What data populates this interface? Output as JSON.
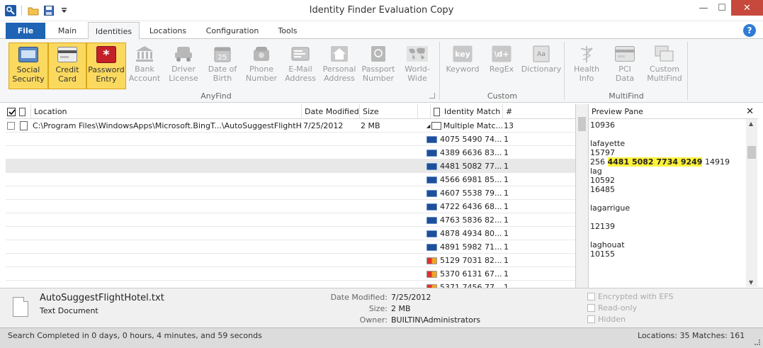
{
  "window": {
    "title": "Identity Finder Evaluation Copy",
    "controls": {
      "minimize": "—",
      "maximize": "☐",
      "close": "✕"
    }
  },
  "tabs": [
    {
      "label": "File"
    },
    {
      "label": "Main"
    },
    {
      "label": "Identities",
      "active": true
    },
    {
      "label": "Locations"
    },
    {
      "label": "Configuration"
    },
    {
      "label": "Tools"
    }
  ],
  "help_label": "?",
  "ribbon": {
    "anyfind": {
      "group_label": "AnyFind",
      "items": [
        {
          "label": "Social\nSecurity",
          "icon": "ssn-card-icon",
          "active": true
        },
        {
          "label": "Credit\nCard",
          "icon": "credit-card-icon",
          "active": true
        },
        {
          "label": "Password\nEntry",
          "icon": "password-icon",
          "active": true
        },
        {
          "label": "Bank\nAccount",
          "icon": "bank-icon"
        },
        {
          "label": "Driver\nLicense",
          "icon": "car-icon"
        },
        {
          "label": "Date of\nBirth",
          "icon": "calendar-icon",
          "icon_text": "25"
        },
        {
          "label": "Phone\nNumber",
          "icon": "phone-icon"
        },
        {
          "label": "E-Mail\nAddress",
          "icon": "email-icon"
        },
        {
          "label": "Personal\nAddress",
          "icon": "house-icon"
        },
        {
          "label": "Passport\nNumber",
          "icon": "passport-icon"
        },
        {
          "label": "World-\nWide",
          "icon": "world-map-icon"
        }
      ]
    },
    "custom": {
      "group_label": "Custom",
      "items": [
        {
          "label": "Keyword",
          "icon": "keyword-icon",
          "icon_text": "key"
        },
        {
          "label": "RegEx",
          "icon": "regex-icon",
          "icon_text": "\\d+"
        },
        {
          "label": "Dictionary",
          "icon": "dictionary-icon",
          "icon_text": "Aa"
        }
      ]
    },
    "multifind": {
      "group_label": "MultiFind",
      "items": [
        {
          "label": "Health\nInfo",
          "icon": "caduceus-icon"
        },
        {
          "label": "PCI\nData",
          "icon": "pci-data-icon"
        },
        {
          "label": "Custom\nMultiFind",
          "icon": "custom-multifind-icon"
        }
      ]
    }
  },
  "grid": {
    "columns": {
      "location": "Location",
      "date_modified": "Date Modified",
      "size": "Size",
      "identity_match": "Identity Match",
      "count": "#"
    },
    "file_row": {
      "location": "C:\\Program Files\\WindowsApps\\Microsoft.BingT...\\AutoSuggestFlightHotel.txt",
      "date_modified": "7/25/2012",
      "size": "2 MB",
      "match": "Multiple Matc...",
      "count": "13"
    },
    "matches": [
      {
        "match": "4075 5490 74...",
        "count": "1",
        "type": "visa"
      },
      {
        "match": "4389 6636 83...",
        "count": "1",
        "type": "visa"
      },
      {
        "match": "4481 5082 77...",
        "count": "1",
        "type": "visa",
        "selected": true
      },
      {
        "match": "4566 6981 85...",
        "count": "1",
        "type": "visa"
      },
      {
        "match": "4607 5538 79...",
        "count": "1",
        "type": "visa"
      },
      {
        "match": "4722 6436 68...",
        "count": "1",
        "type": "visa"
      },
      {
        "match": "4763 5836 82...",
        "count": "1",
        "type": "visa"
      },
      {
        "match": "4878 4934 80...",
        "count": "1",
        "type": "visa"
      },
      {
        "match": "4891 5982 71...",
        "count": "1",
        "type": "visa"
      },
      {
        "match": "5129 7031 82...",
        "count": "1",
        "type": "mastercard"
      },
      {
        "match": "5370 6131 67...",
        "count": "1",
        "type": "mastercard"
      },
      {
        "match": "5371 7456 77...",
        "count": "1",
        "type": "mastercard"
      }
    ]
  },
  "preview": {
    "title": "Preview Pane",
    "close": "✕",
    "lines_before": "10936\n\nlafayette\n15797\n",
    "hit_prefix": "256 ",
    "hit": "4481 5082 7734 9249",
    "hit_suffix": " 14919",
    "lines_after": "\nlag\n10592\n16485\n\nlagarrigue\n\n12139\n\nlaghouat\n10155"
  },
  "details": {
    "filename": "AutoSuggestFlightHotel.txt",
    "filetype": "Text Document",
    "date_label": "Date Modified:",
    "date_value": "7/25/2012",
    "size_label": "Size:",
    "size_value": "2 MB",
    "owner_label": "Owner:",
    "owner_value": "BUILTIN\\Administrators",
    "encrypted": "Encrypted with EFS",
    "readonly": "Read-only",
    "hidden": "Hidden"
  },
  "status": {
    "message": "Search Completed in 0 days, 0 hours, 4 minutes, and 59 seconds",
    "locations": "Locations: 35",
    "matches": "Matches: 161"
  },
  "colors": {
    "file_tab": "#1e63b4",
    "active_button": "#fbd95f",
    "highlight": "#fff23a",
    "close_button": "#c7493d"
  }
}
